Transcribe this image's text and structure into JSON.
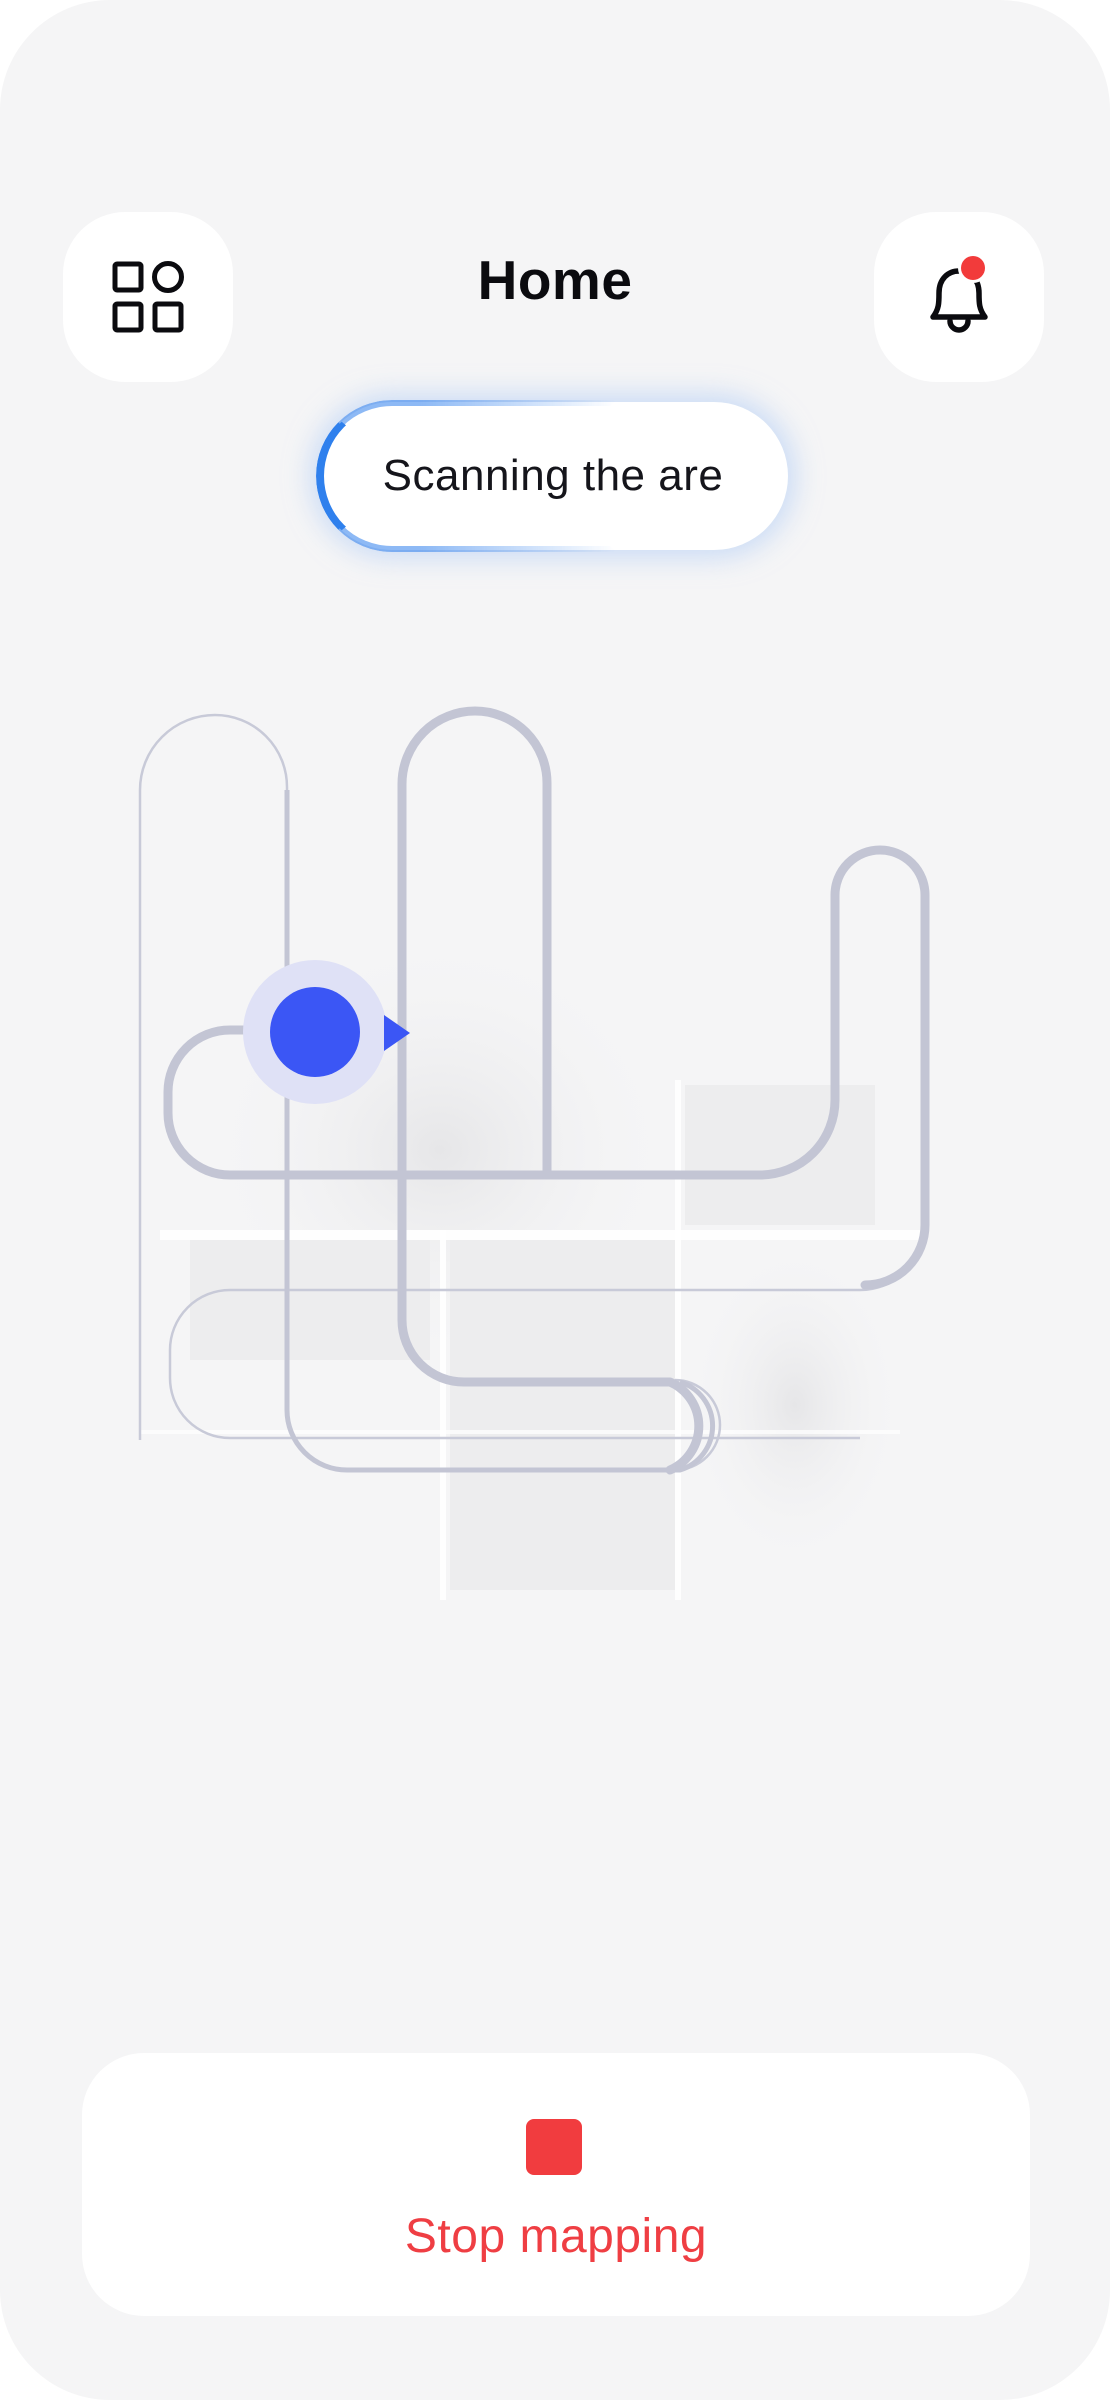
{
  "header": {
    "title": "Home",
    "menu_icon": "grid-menu-icon",
    "notification_icon": "bell-icon",
    "has_unread_notification": true
  },
  "status": {
    "text": "Scanning the are"
  },
  "map": {
    "robot_marker": "robot-position-dot",
    "direction_marker": "heading-arrow-icon"
  },
  "actions": {
    "stop_label": "Stop mapping",
    "stop_icon": "stop-square-icon"
  },
  "colors": {
    "accent_blue": "#3b56f5",
    "scan_glow": "#2f80ed",
    "stop_red": "#f13c3f",
    "path_gray": "#c3c5d4",
    "notification_dot": "#f23b3b"
  }
}
